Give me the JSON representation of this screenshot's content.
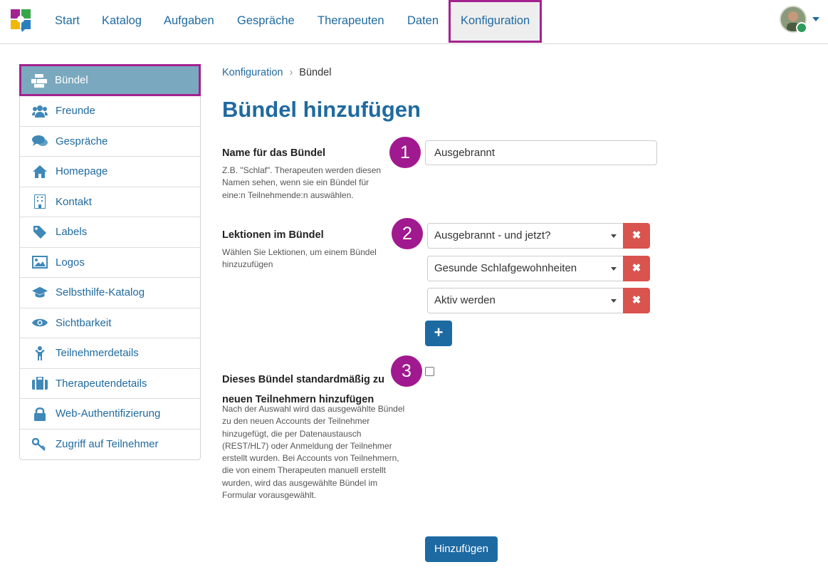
{
  "nav": {
    "logo_icon": "app-logo-icon",
    "items": [
      {
        "label": "Start"
      },
      {
        "label": "Katalog"
      },
      {
        "label": "Aufgaben"
      },
      {
        "label": "Gespräche"
      },
      {
        "label": "Therapeuten"
      },
      {
        "label": "Daten"
      },
      {
        "label": "Konfiguration",
        "active": true
      }
    ],
    "user_icon": "user-avatar",
    "accent_color": "#a3228f"
  },
  "sidebar": {
    "items": [
      {
        "label": "Bündel",
        "icon": "cubes-icon",
        "active": true
      },
      {
        "label": "Freunde",
        "icon": "users-icon"
      },
      {
        "label": "Gespräche",
        "icon": "comments-icon"
      },
      {
        "label": "Homepage",
        "icon": "home-icon"
      },
      {
        "label": "Kontakt",
        "icon": "building-icon"
      },
      {
        "label": "Labels",
        "icon": "tag-icon"
      },
      {
        "label": "Logos",
        "icon": "image-icon"
      },
      {
        "label": "Selbsthilfe-Katalog",
        "icon": "graduation-cap-icon"
      },
      {
        "label": "Sichtbarkeit",
        "icon": "eye-icon"
      },
      {
        "label": "Teilnehmerdetails",
        "icon": "child-icon"
      },
      {
        "label": "Therapeutendetails",
        "icon": "briefcase-icon"
      },
      {
        "label": "Web-Authentifizierung",
        "icon": "lock-icon"
      },
      {
        "label": "Zugriff auf Teilnehmer",
        "icon": "key-icon"
      }
    ]
  },
  "breadcrumb": {
    "parent": "Konfiguration",
    "separator": "›",
    "current": "Bündel"
  },
  "page_title": "Bündel hinzufügen",
  "form": {
    "name": {
      "label": "Name für das Bündel",
      "help": "Z.B. \"Schlaf\". Therapeuten werden diesen Namen sehen, wenn sie ein Bündel für eine:n Teilnehmende:n auswählen.",
      "value": "Ausgebrannt",
      "marker": "1"
    },
    "lessons": {
      "label": "Lektionen im Bündel",
      "help": "Wählen Sie Lektionen, um einem Bündel hinzuzufügen",
      "marker": "2",
      "selected": [
        "Ausgebrannt - und jetzt?",
        "Gesunde Schlafgewohnheiten",
        "Aktiv werden"
      ],
      "remove_symbol": "✖",
      "add_symbol": "+"
    },
    "default": {
      "label": "Dieses Bündel standardmäßig zu neuen Teilnehmern hinzufügen",
      "help": "Nach der Auswahl wird das ausgewählte Bündel zu den neuen Accounts der Teilnehmer hinzugefügt, die per Datenaustausch (REST/HL7) oder Anmeldung der Teilnehmer erstellt wurden. Bei Accounts von Teilnehmern, die von einem Therapeuten manuell erstellt wurden, wird das ausgewählte Bündel im Formular vorausgewählt.",
      "marker": "3",
      "checked": false
    },
    "submit_label": "Hinzufügen"
  },
  "colors": {
    "primary": "#1f6aa0",
    "danger": "#d9534f",
    "sidebar_active": "#7aa9bf",
    "marker": "#a1198f"
  }
}
